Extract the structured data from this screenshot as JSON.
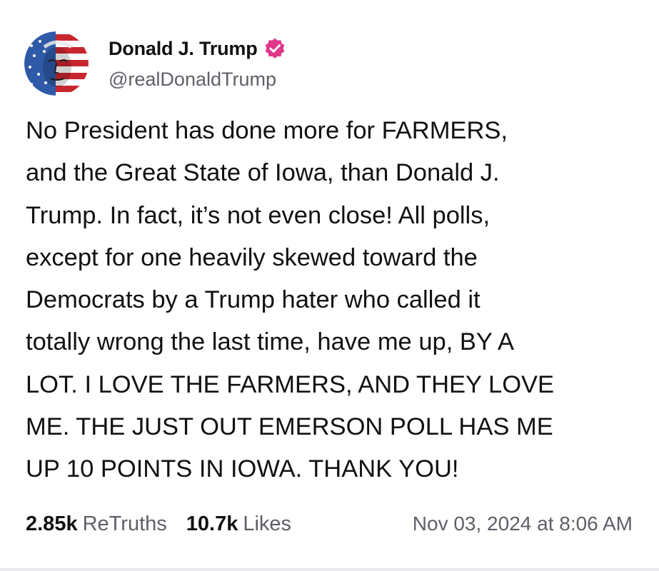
{
  "post": {
    "author": {
      "display_name": "Donald J. Trump",
      "handle": "@realDonaldTrump",
      "verified": true,
      "verified_color": "#e0368c",
      "avatar": "avatar-flag-face"
    },
    "text": "No President has done more for FARMERS,\nand the Great State of Iowa, than Donald J.\nTrump. In fact, it’s not even close! All polls,\nexcept for one heavily skewed toward the\nDemocrats by a Trump hater who called it\ntotally wrong the last time, have me up, BY A\nLOT. I LOVE THE FARMERS, AND THEY LOVE\nME. THE JUST OUT EMERSON POLL HAS ME\nUP 10 POINTS IN IOWA. THANK YOU!",
    "stats": {
      "retruths_count": "2.85k",
      "retruths_label": "ReTruths",
      "likes_count": "10.7k",
      "likes_label": "Likes"
    },
    "timestamp": "Nov 03, 2024 at 8:06 AM"
  },
  "colors": {
    "text_primary": "#111111",
    "text_secondary": "#5f5f68",
    "verified_badge": "#e0368c"
  }
}
